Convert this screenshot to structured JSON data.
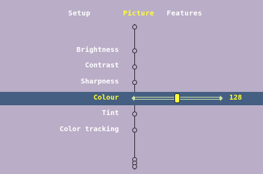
{
  "tabs": [
    {
      "label": "Setup",
      "active": false
    },
    {
      "label": "Picture",
      "active": true
    },
    {
      "label": "Features",
      "active": false
    }
  ],
  "menu": {
    "items": [
      {
        "label": "Brightness"
      },
      {
        "label": "Contrast"
      },
      {
        "label": "Sharpness"
      },
      {
        "label": "Colour",
        "selected": true,
        "slider_fraction": 0.5
      },
      {
        "label": "Tint"
      },
      {
        "label": "Color tracking"
      }
    ],
    "selected_value": "128"
  },
  "colors": {
    "background": "#b9adc7",
    "highlight": "#445f82",
    "active_text": "#ffff3a",
    "text": "#ffffff"
  }
}
